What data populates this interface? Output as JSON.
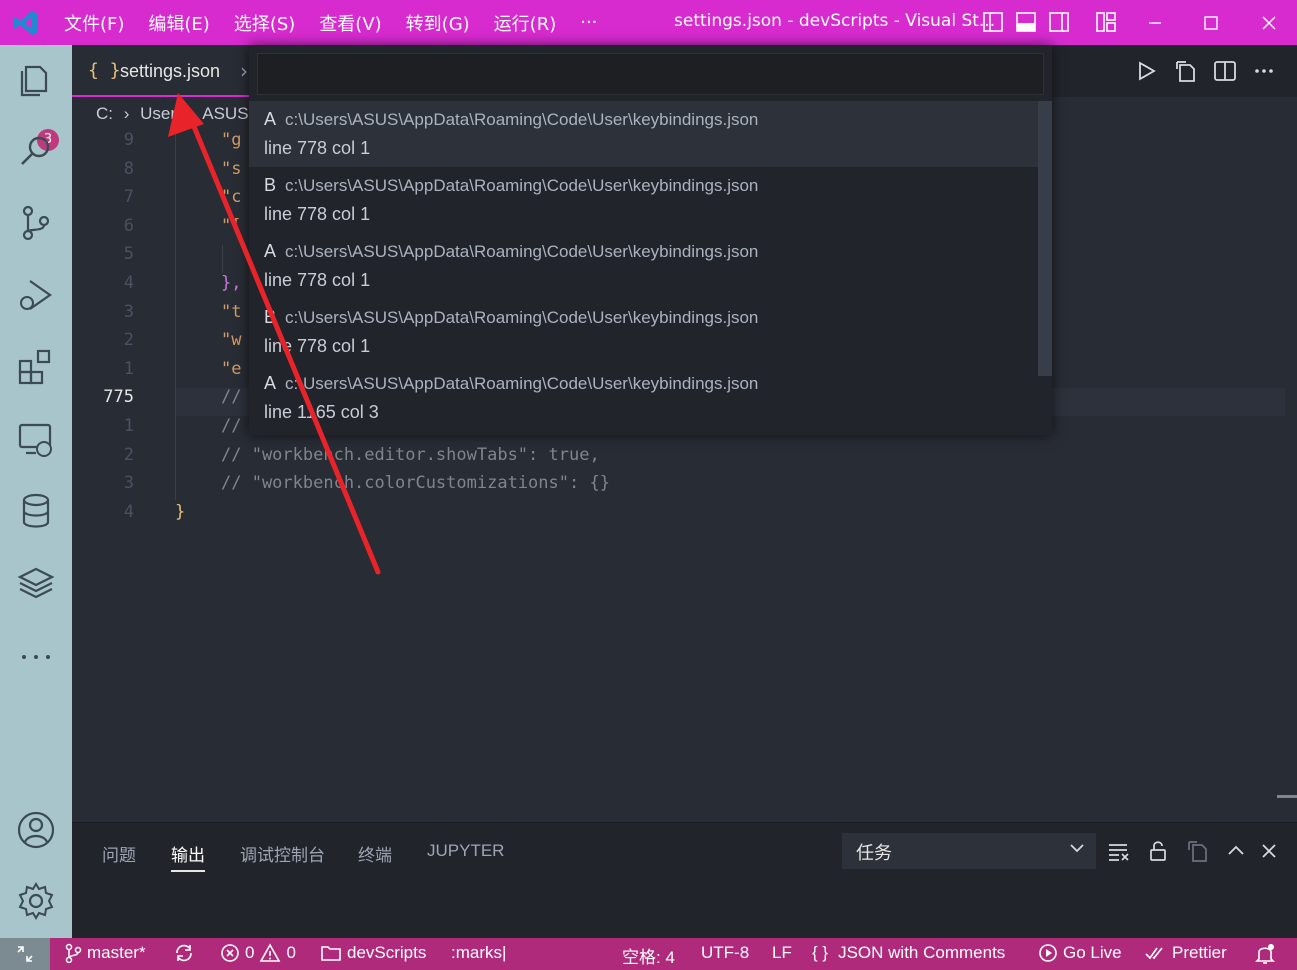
{
  "titlebar": {
    "menu": [
      "文件(F)",
      "编辑(E)",
      "选择(S)",
      "查看(V)",
      "转到(G)",
      "运行(R)",
      "···"
    ],
    "title": "settings.json - devScripts - Visual St...",
    "window_controls": [
      "minimize-icon",
      "maximize-icon",
      "close-icon"
    ]
  },
  "activitybar": {
    "items": [
      "explorer-icon",
      "search-icon",
      "source-control-icon",
      "run-debug-icon",
      "extensions-icon",
      "remote-explorer-icon",
      "database-icon",
      "layers-icon",
      "more-icon"
    ],
    "explorer_badge": "3",
    "bottom": [
      "account-icon",
      "settings-gear-icon"
    ]
  },
  "tab": {
    "braces": "{ }",
    "label": "settings.json",
    "chevron": "›"
  },
  "breadcrumb": [
    "C:",
    "›",
    "User",
    "›",
    "ASUS"
  ],
  "editor": {
    "line_numbers": [
      "9",
      "8",
      "7",
      "6",
      "5",
      "4",
      "3",
      "2",
      "1",
      "775",
      "1",
      "2",
      "3",
      "4"
    ],
    "current_line": "775",
    "lines": [
      {
        "prefix": "\"g",
        "cls": "str"
      },
      {
        "prefix": "\"s",
        "cls": "str"
      },
      {
        "prefix": "\"c",
        "cls": "str"
      },
      {
        "prefix": "\"[",
        "cls": "str"
      },
      {
        "prefix": "",
        "cls": "str"
      },
      {
        "prefix": "},",
        "cls": "punc"
      },
      {
        "prefix": "\"t",
        "cls": "str"
      },
      {
        "prefix": "\"w",
        "cls": "str"
      },
      {
        "prefix": "\"e",
        "cls": "str"
      },
      {
        "prefix": "//",
        "cls": "cmt"
      },
      {
        "prefix": "//",
        "cls": "cmt"
      },
      {
        "prefix": "// \"workbench.editor.showTabs\": true,",
        "cls": "cmt"
      },
      {
        "prefix": "// \"workbench.colorCustomizations\": {}",
        "cls": "cmt"
      },
      {
        "prefix": "}",
        "cls": "brace"
      }
    ]
  },
  "quickpick": {
    "input_value": "",
    "items": [
      {
        "key": "A",
        "path": "c:\\Users\\ASUS\\AppData\\Roaming\\Code\\User\\keybindings.json",
        "desc": "line 778 col 1"
      },
      {
        "key": "B",
        "path": "c:\\Users\\ASUS\\AppData\\Roaming\\Code\\User\\keybindings.json",
        "desc": "line 778 col 1"
      },
      {
        "key": "A",
        "path": "c:\\Users\\ASUS\\AppData\\Roaming\\Code\\User\\keybindings.json",
        "desc": "line 778 col 1"
      },
      {
        "key": "B",
        "path": "c:\\Users\\ASUS\\AppData\\Roaming\\Code\\User\\keybindings.json",
        "desc": "line 778 col 1"
      },
      {
        "key": "A",
        "path": "c:\\Users\\ASUS\\AppData\\Roaming\\Code\\User\\keybindings.json",
        "desc": "line 1165 col 3"
      }
    ]
  },
  "panel": {
    "tabs": [
      "问题",
      "输出",
      "调试控制台",
      "终端",
      "JUPYTER"
    ],
    "active_tab": "输出",
    "task_select": "任务"
  },
  "statusbar": {
    "branch": "master*",
    "errors": "0",
    "warnings": "0",
    "folder": "devScripts",
    "marks": ":marks|",
    "spaces": "空格: 4",
    "encoding": "UTF-8",
    "eol": "LF",
    "language": "JSON with Comments",
    "go_live": "Go Live",
    "prettier": "Prettier"
  },
  "colors": {
    "titlebar": "#d72bd0",
    "statusbar": "#b02a7c",
    "activitybar": "#a7c5cb",
    "arrow": "#e8242a"
  }
}
